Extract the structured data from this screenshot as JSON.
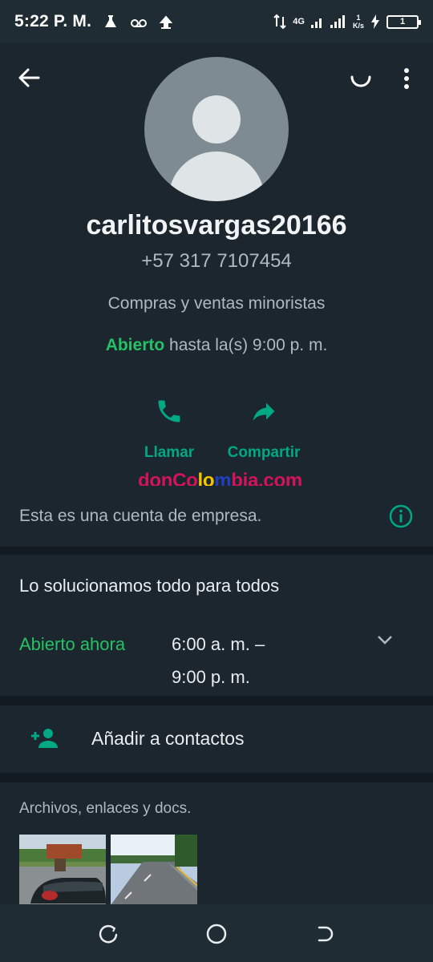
{
  "status_bar": {
    "time": "5:22 P. M.",
    "network": "4G",
    "speed_value": "1",
    "speed_unit": "K/s",
    "battery": "1"
  },
  "profile": {
    "name": "carlitosvargas20166",
    "phone": "+57 317 7107454",
    "category": "Compras y ventas minoristas",
    "hours_open": "Abierto",
    "hours_rest": "hasta la(s) 9:00 p. m."
  },
  "actions": {
    "call_label": "Llamar",
    "share_label": "Compartir"
  },
  "watermark": {
    "part1": "donCo",
    "part2": "lo",
    "part3": "m",
    "part4": "bia.com"
  },
  "business_notice": "Esta es una cuenta de empresa.",
  "description": "Lo solucionamos todo para todos",
  "schedule": {
    "status": "Abierto ahora",
    "line1": "6:00 a. m. –",
    "line2": "9:00 p. m."
  },
  "add_contact_label": "Añadir a contactos",
  "media": {
    "title": "Archivos, enlaces y docs."
  },
  "colors": {
    "accent": "#00a884",
    "open_green": "#26c165",
    "background": "#121b22",
    "panel": "#1b262e"
  },
  "icons": [
    "back-arrow-icon",
    "loading-icon",
    "more-vert-icon",
    "phone-icon",
    "share-icon",
    "info-icon",
    "chevron-down-icon",
    "add-person-icon"
  ]
}
